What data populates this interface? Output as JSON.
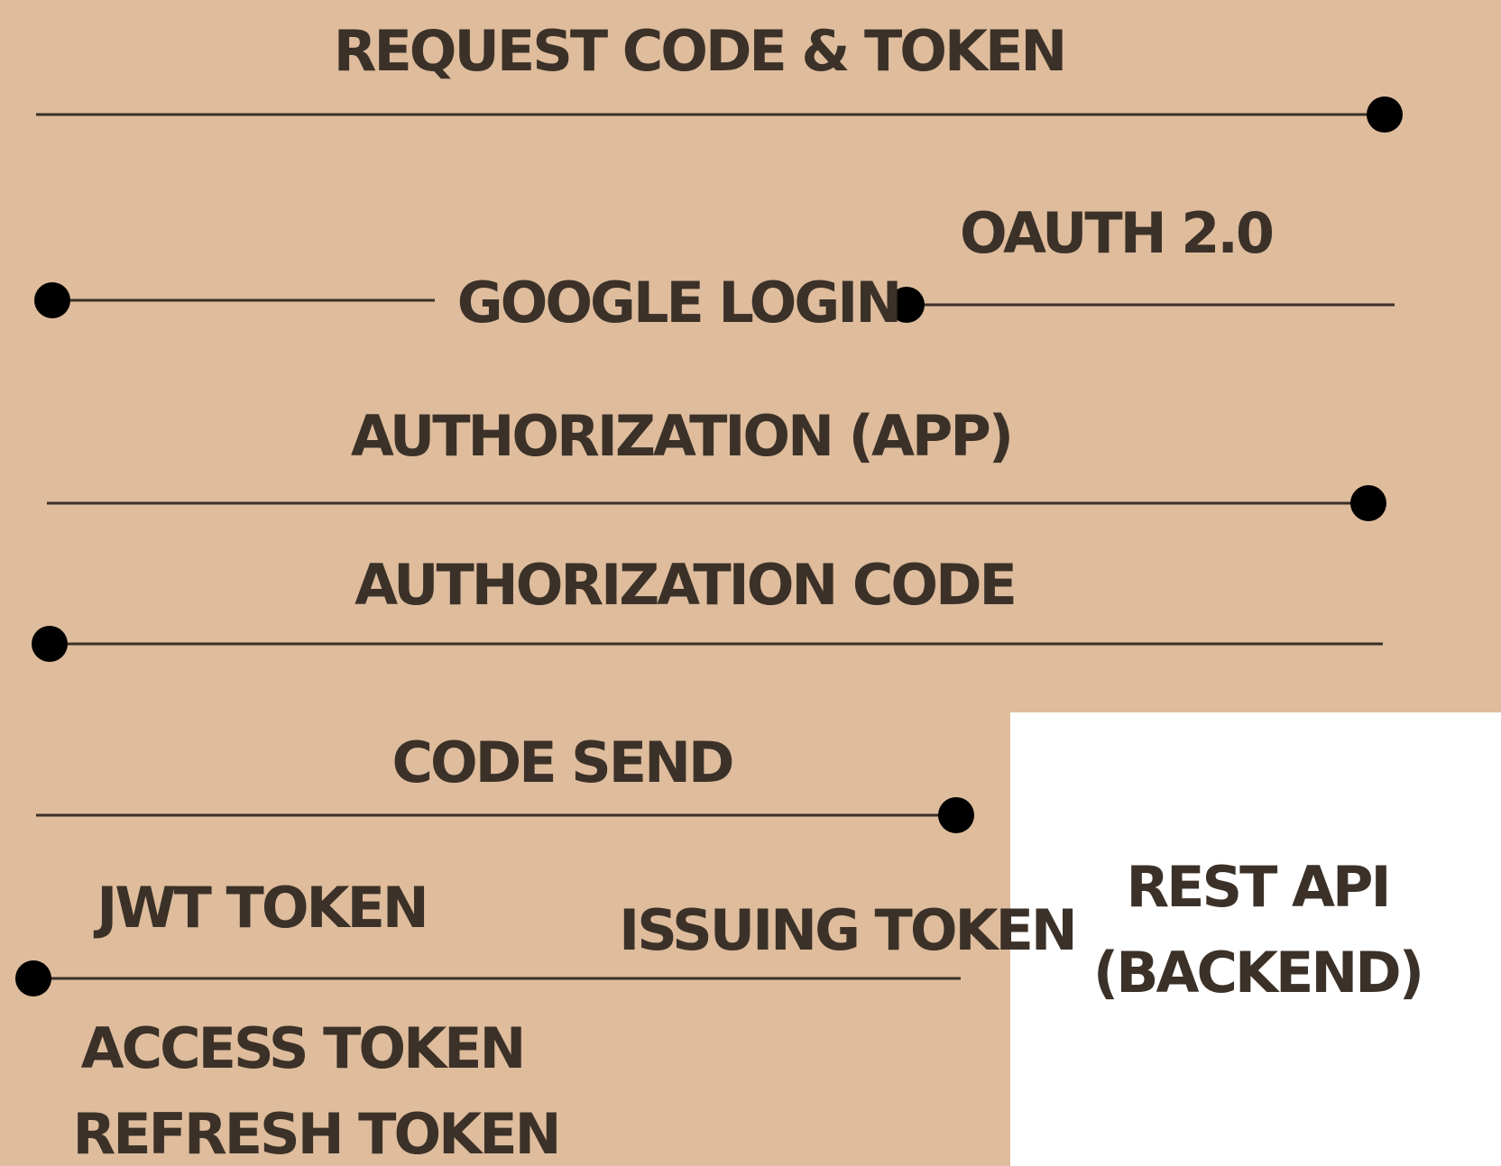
{
  "colors": {
    "panel": "#debc9c",
    "backend_box": "#ffffff",
    "line": "#3b3128",
    "dot": "#000000",
    "text": "#3b3128"
  },
  "labels": {
    "request_code_token": "REQUEST CODE & TOKEN",
    "oauth": "OAUTH 2.0",
    "google_login": "GOOGLE LOGIN",
    "authorization_app": "AUTHORIZATION (APP)",
    "authorization_code": "AUTHORIZATION CODE",
    "code_send": "CODE SEND",
    "jwt_token": "JWT TOKEN",
    "issuing_token": "ISSUING TOKEN",
    "access_token": "ACCESS TOKEN",
    "refresh_token": "REFRESH TOKEN",
    "rest_api_line1": "REST API",
    "rest_api_line2": "(BACKEND)"
  }
}
